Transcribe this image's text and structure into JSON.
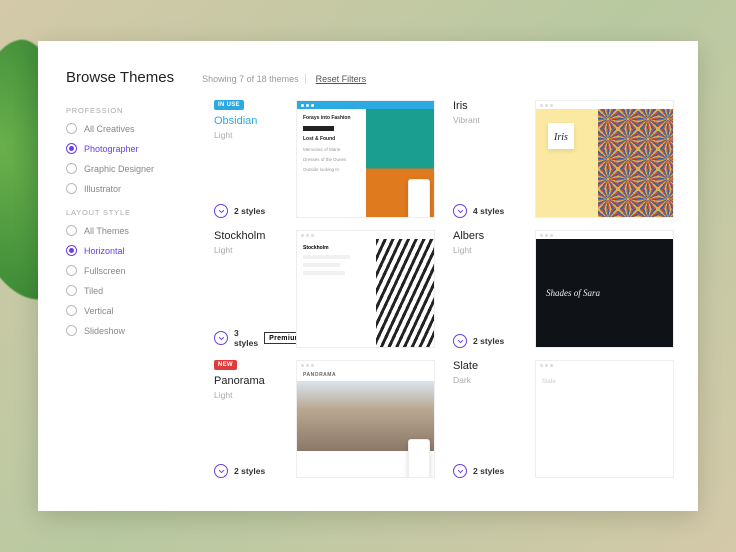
{
  "page": {
    "title": "Browse Themes",
    "count_text": "Showing 7 of 18 themes",
    "reset": "Reset Filters"
  },
  "filters": {
    "profession": {
      "label": "PROFESSION",
      "options": [
        "All Creatives",
        "Photographer",
        "Graphic Designer",
        "Illustrator"
      ],
      "selected": 1
    },
    "layout": {
      "label": "LAYOUT STYLE",
      "options": [
        "All Themes",
        "Horizontal",
        "Fullscreen",
        "Tiled",
        "Vertical",
        "Slideshow"
      ],
      "selected": 1
    }
  },
  "themes": [
    {
      "name": "Obsidian",
      "subtitle": "Light",
      "badge": "IN USE",
      "badge_color": "#2da9e1",
      "styles": "2 styles",
      "accent": true,
      "preview": "obsidian",
      "preview_text": {
        "heading": "Forays into Fashion",
        "item1": "Lost & Found",
        "item2": "Memories of Marie",
        "item3": "Dresses of the Dunes",
        "item4": "Outside looking In"
      }
    },
    {
      "name": "Iris",
      "subtitle": "Vibrant",
      "styles": "4 styles",
      "preview": "iris",
      "preview_text": {
        "title": "Iris"
      }
    },
    {
      "name": "Stockholm",
      "subtitle": "Light",
      "styles": "3 styles",
      "premium": "Premium",
      "preview": "stockholm",
      "preview_text": {
        "heading": "Stockholm"
      }
    },
    {
      "name": "Albers",
      "subtitle": "Light",
      "styles": "2 styles",
      "preview": "albers",
      "preview_text": {
        "title": "Shades of Sara"
      }
    },
    {
      "name": "Panorama",
      "subtitle": "Light",
      "badge": "NEW",
      "badge_color": "#e13c3c",
      "styles": "2 styles",
      "preview": "panorama",
      "preview_text": {
        "brand": "PANORAMA"
      }
    },
    {
      "name": "Slate",
      "subtitle": "Dark",
      "styles": "2 styles",
      "preview": "slate",
      "preview_text": {
        "brand": "Slate"
      }
    }
  ]
}
